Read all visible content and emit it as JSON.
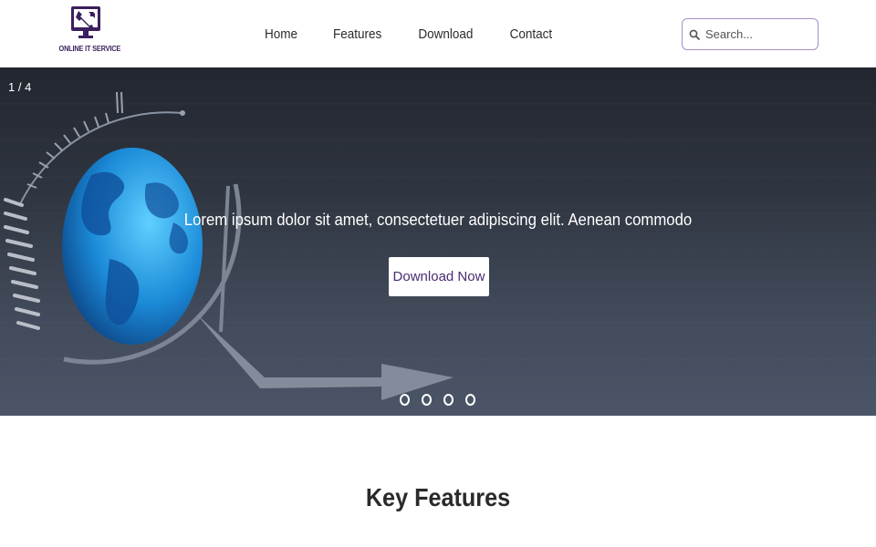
{
  "brand": {
    "name": "ONLINE IT SERVICE",
    "color": "#3b1f5e"
  },
  "nav": {
    "items": [
      "Home",
      "Features",
      "Download",
      "Contact"
    ]
  },
  "search": {
    "placeholder": "Search..."
  },
  "hero": {
    "counter": "1 / 4",
    "caption": "Lorem ipsum dolor sit amet, consectetuer adipiscing elit. Aenean commodo",
    "cta_label": "Download Now",
    "slide_count": 4,
    "active_slide": 1
  },
  "features": {
    "title": "Key Features"
  },
  "colors": {
    "accent": "#4a2a70",
    "search_border": "#a88fc8"
  }
}
